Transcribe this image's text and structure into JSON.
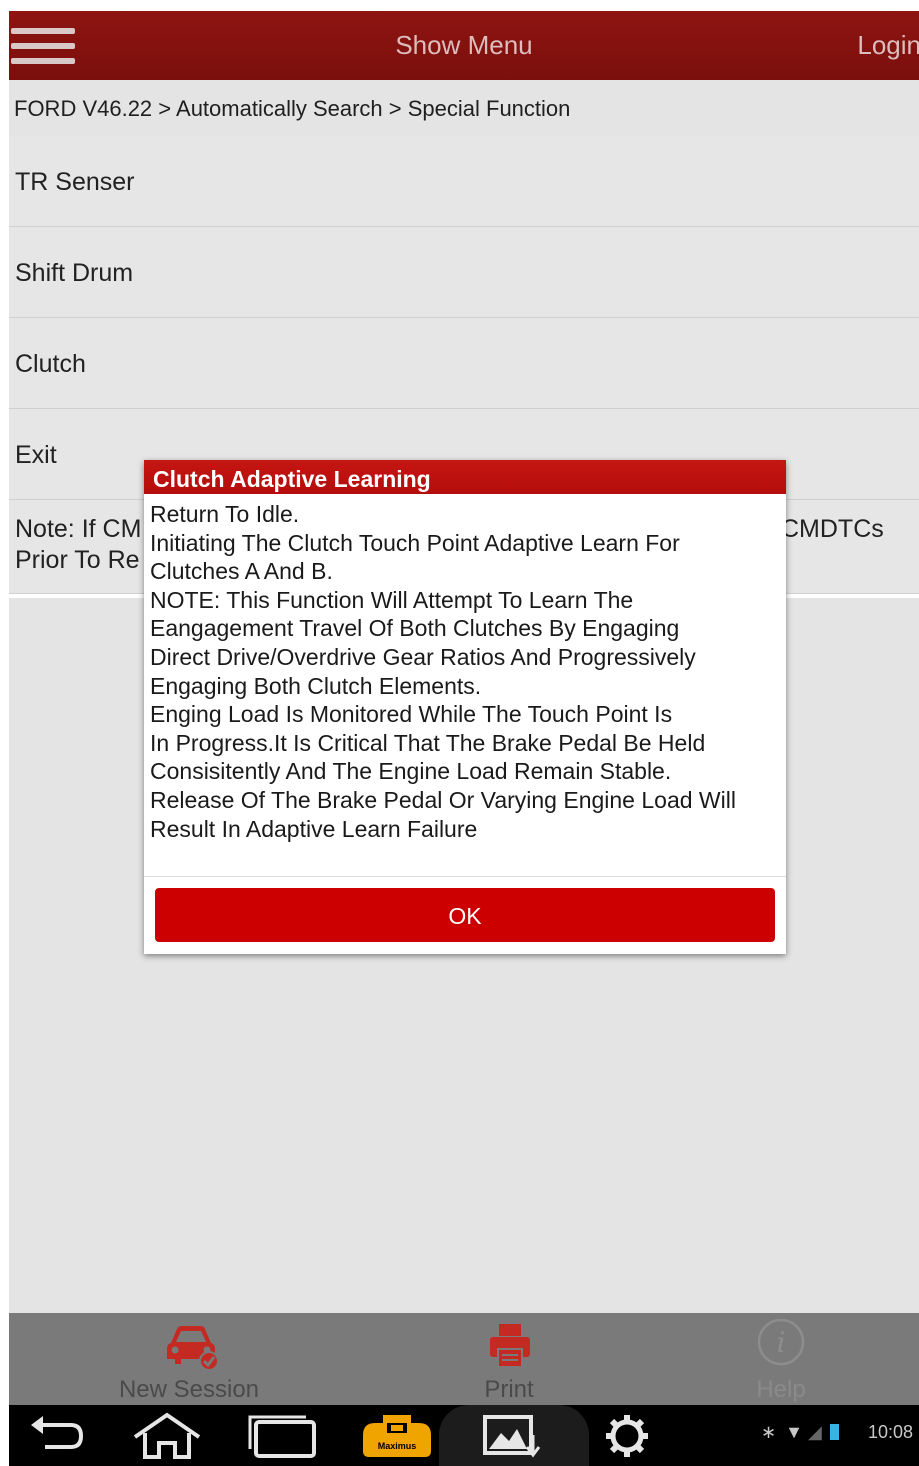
{
  "header": {
    "menu_label": "Show Menu",
    "login_label": "Login"
  },
  "breadcrumb": "FORD V46.22 > Automatically Search > Special Function",
  "list": {
    "items": [
      "TR Senser",
      "Shift Drum",
      "Clutch",
      "Exit"
    ],
    "note_line1_left": "Note: If CM",
    "note_line1_right": "CMDTCs",
    "note_line2_left": "Prior To Re"
  },
  "dialog": {
    "title": "Clutch Adaptive Learning",
    "lines": [
      "Return To Idle.",
      "Initiating The Clutch Touch Point Adaptive Learn For",
      "Clutches A And B.",
      "NOTE: This Function Will Attempt To Learn The",
      "Eangagement Travel Of Both Clutches By Engaging",
      "Direct Drive/Overdrive Gear Ratios And Progressively",
      "Engaging Both Clutch Elements.",
      "Enging Load Is Monitored While The Touch Point Is",
      "In Progress.It Is Critical That The Brake Pedal Be Held",
      "Consisitently And The Engine Load Remain Stable.",
      "Release Of The Brake Pedal Or Varying Engine Load Will",
      "Result In Adaptive Learn Failure"
    ],
    "ok_label": "OK"
  },
  "actions": {
    "new_session": "New Session",
    "print": "Print",
    "help": "Help"
  },
  "system_bar": {
    "time": "10:08",
    "logo_text": "Maximus"
  },
  "colors": {
    "header_bg": "#7a0f0c",
    "dialog_title_bg": "#c51613",
    "ok_button_bg": "#cc0000",
    "action_bar_bg": "#7a7a7a"
  },
  "icons": {
    "menu": "hamburger-icon",
    "new_session": "car-icon",
    "print": "printer-icon",
    "help": "info-icon",
    "back": "back-icon",
    "home": "home-icon",
    "recents": "recent-apps-icon",
    "app_logo": "maximus-icon",
    "screenshot": "screenshot-icon",
    "settings": "gear-icon"
  }
}
